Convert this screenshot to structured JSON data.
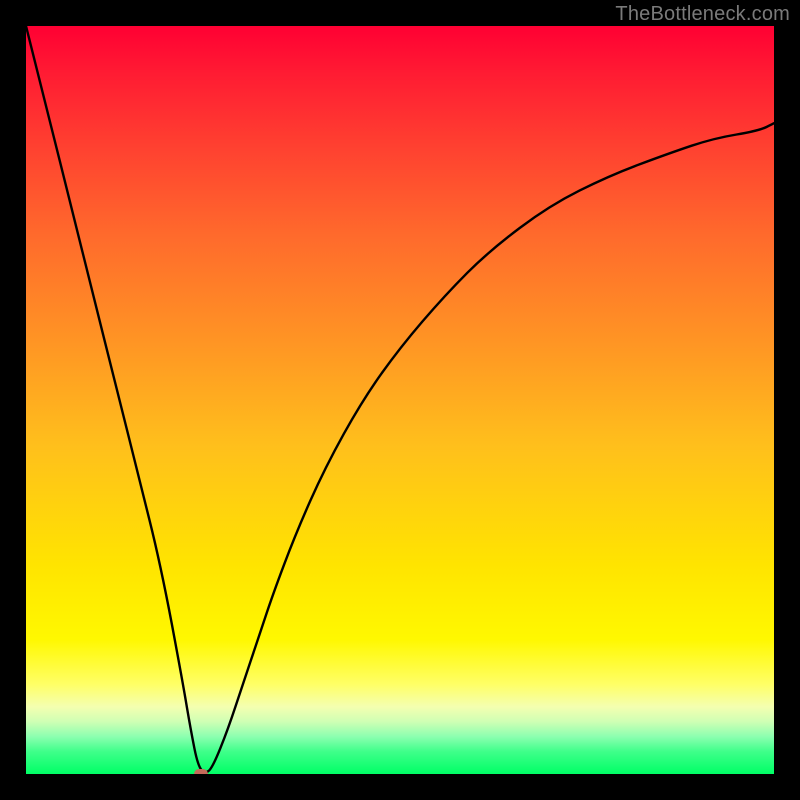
{
  "watermark": "TheBottleneck.com",
  "chart_data": {
    "type": "line",
    "title": "",
    "xlabel": "",
    "ylabel": "",
    "xlim": [
      0,
      100
    ],
    "ylim": [
      0,
      100
    ],
    "grid": false,
    "legend": false,
    "series": [
      {
        "name": "bottleneck-curve",
        "x": [
          0,
          3,
          6,
          9,
          12,
          15,
          18,
          21,
          22,
          23,
          24,
          25,
          27,
          29,
          31,
          33,
          36,
          40,
          45,
          50,
          56,
          62,
          70,
          78,
          86,
          92,
          98,
          100
        ],
        "y": [
          100,
          88,
          76,
          64,
          52,
          40,
          28,
          12,
          6,
          1,
          0,
          1,
          6,
          12,
          18,
          24,
          32,
          41,
          50,
          57,
          64,
          70,
          76,
          80,
          83,
          85,
          86,
          87
        ]
      }
    ],
    "marker": {
      "x": 23.4,
      "y": 0
    },
    "background_gradient": {
      "top": "#ff0033",
      "mid": "#ffe400",
      "bottom": "#00ff66"
    }
  }
}
